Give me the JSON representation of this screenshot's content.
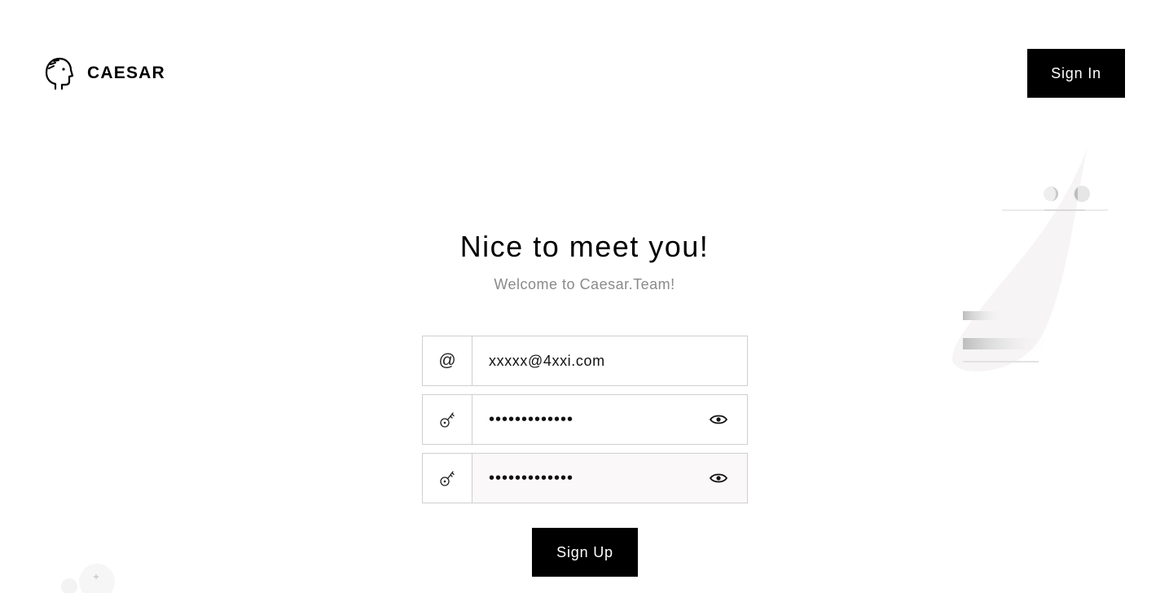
{
  "brand": {
    "name": "CAESAR",
    "icon": "caesar-head-logo-icon"
  },
  "header": {
    "signin_label": "Sign In"
  },
  "main": {
    "title": "Nice to meet you!",
    "subtitle": "Welcome to Caesar.Team!"
  },
  "form": {
    "email": {
      "icon": "at-icon",
      "icon_glyph": "@",
      "value": "xxxxx@4xxi.com"
    },
    "password": {
      "icon": "key-icon",
      "value": "xxxxxxxxxxxxx",
      "toggle_icon": "eye-icon"
    },
    "confirm_password": {
      "icon": "key-icon",
      "value": "xxxxxxxxxxxxx",
      "toggle_icon": "eye-icon"
    },
    "submit_label": "Sign Up"
  },
  "colors": {
    "primary": "#000000",
    "subtitle": "#8a8a8a",
    "border": "#cfcfcf",
    "active_field_bg": "#faf8f8"
  }
}
